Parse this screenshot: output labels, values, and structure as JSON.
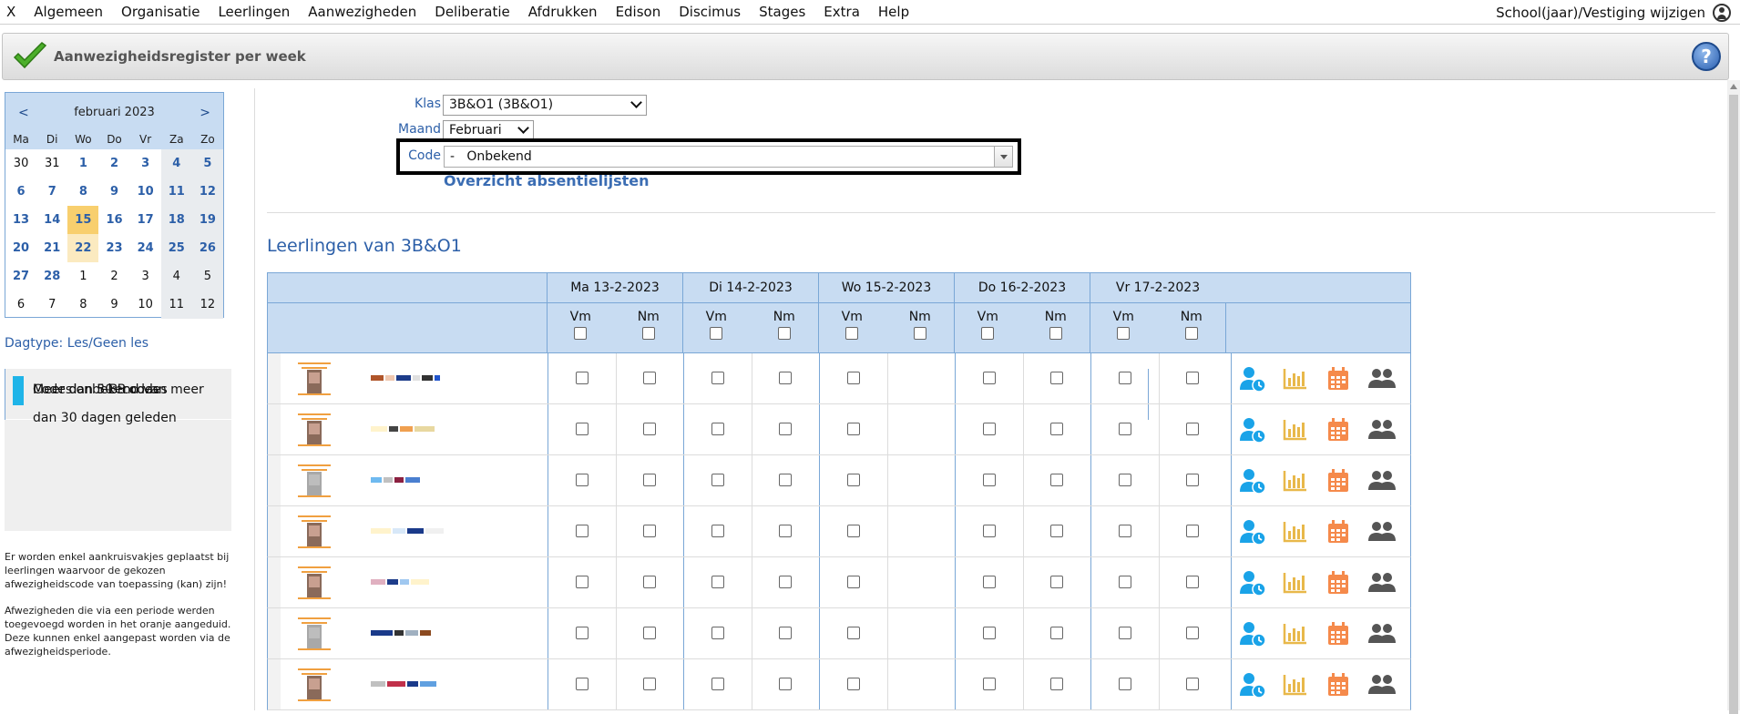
{
  "menu": {
    "close": "X",
    "items": [
      "Algemeen",
      "Organisatie",
      "Leerlingen",
      "Aanwezigheden",
      "Deliberatie",
      "Afdrukken",
      "Edison",
      "Discimus",
      "Stages",
      "Extra",
      "Help"
    ],
    "right_link": "School(jaar)/Vestiging wijzigen"
  },
  "header": {
    "title": "Aanwezigheidsregister per week",
    "help": "?"
  },
  "calendar": {
    "prev": "<",
    "next": ">",
    "month": "februari 2023",
    "dow": [
      "Ma",
      "Di",
      "Wo",
      "Do",
      "Vr",
      "Za",
      "Zo"
    ],
    "days": [
      [
        "30",
        "31",
        "1",
        "2",
        "3",
        "4",
        "5"
      ],
      [
        "6",
        "7",
        "8",
        "9",
        "10",
        "11",
        "12"
      ],
      [
        "13",
        "14",
        "15",
        "16",
        "17",
        "18",
        "19"
      ],
      [
        "20",
        "21",
        "22",
        "23",
        "24",
        "25",
        "26"
      ],
      [
        "27",
        "28",
        "1",
        "2",
        "3",
        "4",
        "5"
      ],
      [
        "6",
        "7",
        "8",
        "9",
        "10",
        "11",
        "12"
      ]
    ]
  },
  "daytype": "Dagtype: Les/Geen les",
  "legend": [
    {
      "color": "#f7941d",
      "label": "Meer dan 5-B codes"
    },
    {
      "color": "#b91c1c",
      "label": "Meer dan 30-B codes"
    },
    {
      "color": "#1fb4e8",
      "label": "Codes onbekend van meer dan 30 dagen geleden"
    }
  ],
  "notes": {
    "p1": "Er worden enkel aankruisvakjes geplaatst bij leerlingen waarvoor de gekozen afwezigheidscode van toepassing (kan) zijn!",
    "p2": "Afwezigheden die via een periode werden toegevoegd worden in het oranje aangeduid. Deze kunnen enkel aangepast worden via de afwezigheidsperiode."
  },
  "form": {
    "klas_label": "Klas",
    "klas_value": "3B&O1 (3B&O1)",
    "maand_label": "Maand",
    "maand_value": "Februari",
    "code_label": "Code",
    "code_value": "-   Onbekend",
    "overview_link": "Overzicht absentielijsten"
  },
  "section_title": "Leerlingen van 3B&O1",
  "table": {
    "days": [
      "Ma 13-2-2023",
      "Di 14-2-2023",
      "Wo 15-2-2023",
      "Do 16-2-2023",
      "Vr 17-2-2023"
    ],
    "sub": [
      "Vm",
      "Nm"
    ]
  },
  "colors": {
    "accent_blue": "#2c5fa8",
    "header_bg": "#c8dcf2",
    "icon_person": "#1aa3e8",
    "icon_chart": "#e8b84a",
    "icon_calendar": "#f58a4b",
    "icon_group": "#555555"
  },
  "icons": [
    "person-clock-icon",
    "bar-chart-icon",
    "calendar-icon",
    "group-icon"
  ]
}
